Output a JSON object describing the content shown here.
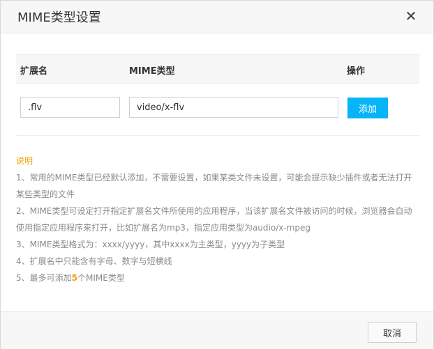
{
  "dialog": {
    "title": "MIME类型设置",
    "close_icon": "close-icon"
  },
  "table": {
    "headers": {
      "ext": "扩展名",
      "mime": "MIME类型",
      "op": "操作"
    },
    "row": {
      "ext_value": ".flv",
      "mime_value": "video/x-flv",
      "add_label": "添加"
    }
  },
  "notes": {
    "heading": "说明",
    "line1a": "1、常用的MIME类型已经默认添加，不需要设置，如果某类文件未设置，可能会提示缺少插件或者无法打开",
    "line1b": "某些类型的文件",
    "line2a": "2、MIME类型可设定打开指定扩展名文件所使用的应用程序，当该扩展名文件被访问的时候，浏览器会自动",
    "line2b": "使用指定应用程序来打开，比如扩展名为mp3，指定应用类型为audio/x-mpeg",
    "line3": "3、MIME类型格式为：xxxx/yyyy，其中xxxx为主类型，yyyy为子类型",
    "line4": "4、扩展名中只能含有字母、数字与短横线",
    "line5_pre": "5、最多可添加",
    "line5_num": "5",
    "line5_post": "个MIME类型"
  },
  "footer": {
    "cancel_label": "取消"
  },
  "colors": {
    "accent_button": "#08b4f8",
    "note_heading": "#f0a20a"
  }
}
